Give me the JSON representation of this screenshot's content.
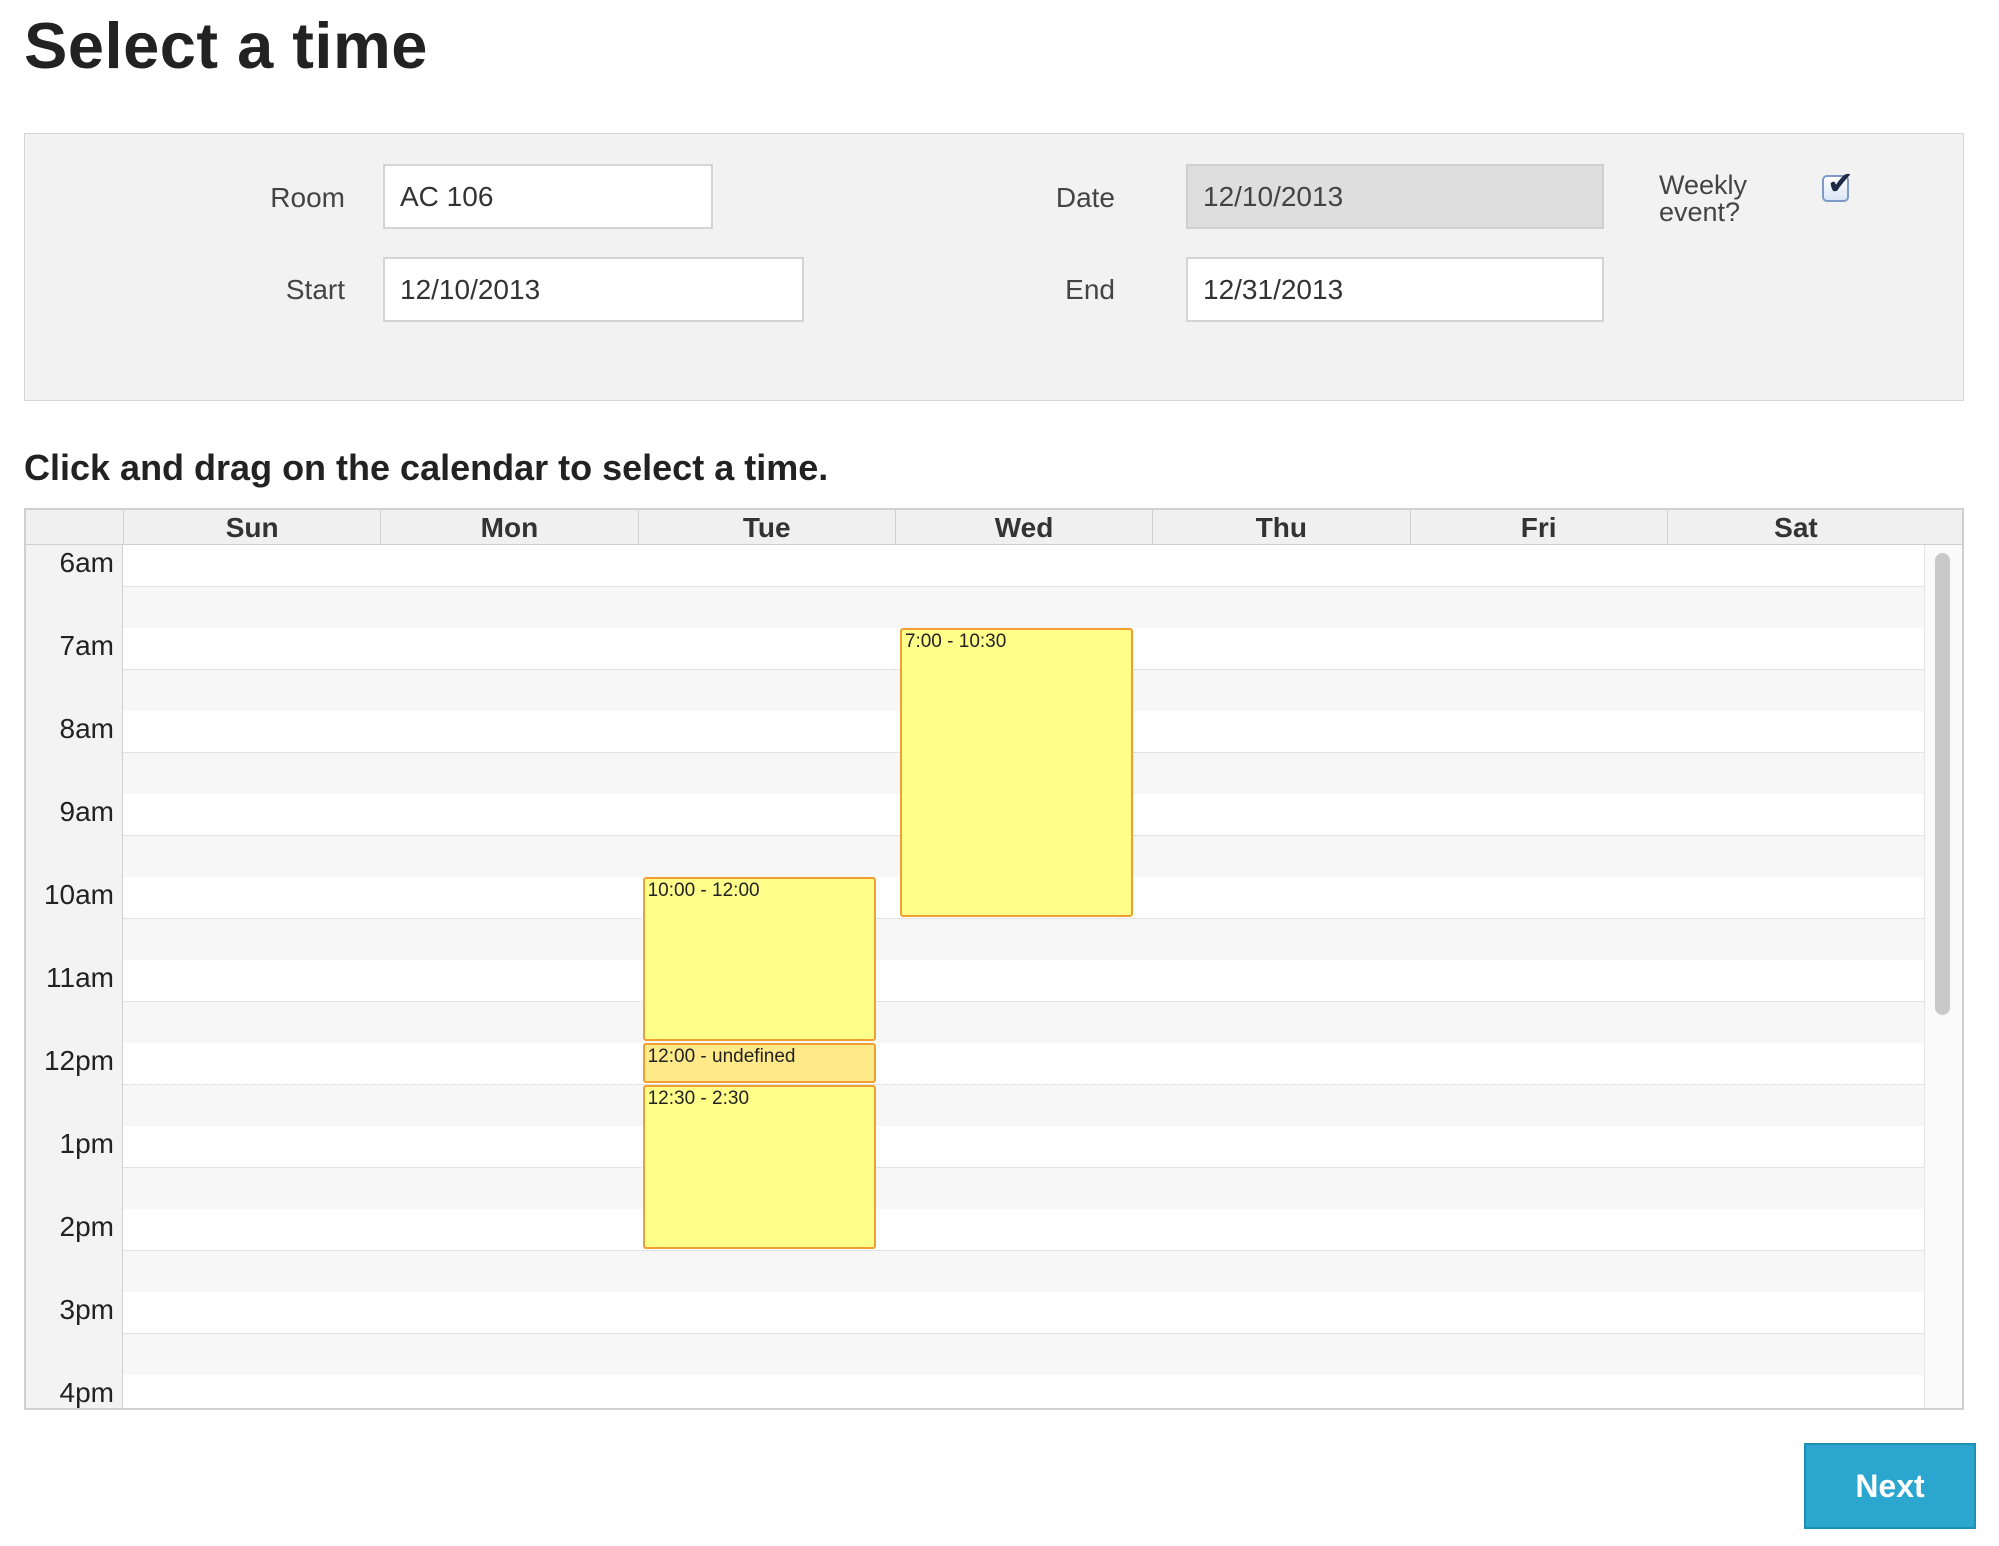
{
  "page": {
    "title": "Select a time"
  },
  "form": {
    "room_label": "Room",
    "room_value": "AC 106",
    "date_label": "Date",
    "date_value": "12/10/2013",
    "start_label": "Start",
    "start_value": "12/10/2013",
    "end_label": "End",
    "end_value": "12/31/2013",
    "weekly_label_line1": "Weekly",
    "weekly_label_line2": "event?",
    "weekly_checked": true
  },
  "instructions": "Click and drag on the calendar to select a time.",
  "calendar": {
    "days": [
      "Sun",
      "Mon",
      "Tue",
      "Wed",
      "Thu",
      "Fri",
      "Sat"
    ],
    "hours": [
      "6am",
      "7am",
      "8am",
      "9am",
      "10am",
      "11am",
      "12pm",
      "1pm",
      "2pm",
      "3pm",
      "4pm"
    ],
    "events": [
      {
        "label": "7:00 - 10:30",
        "day_index": 3,
        "start_hour": 7.0,
        "end_hour": 10.5,
        "style": "normal"
      },
      {
        "label": "10:00 - 12:00",
        "day_index": 2,
        "start_hour": 10.0,
        "end_hour": 12.0,
        "style": "normal"
      },
      {
        "label": "12:00 - undefined",
        "day_index": 2,
        "start_hour": 12.0,
        "end_hour": 12.5,
        "style": "small"
      },
      {
        "label": "12:30 - 2:30",
        "day_index": 2,
        "start_hour": 12.5,
        "end_hour": 14.5,
        "style": "normal"
      }
    ]
  },
  "buttons": {
    "next_label": "Next"
  },
  "colors": {
    "event_fill": "#ffff8a",
    "event_border": "#f0a030",
    "next_button": "#2aa6cf"
  }
}
